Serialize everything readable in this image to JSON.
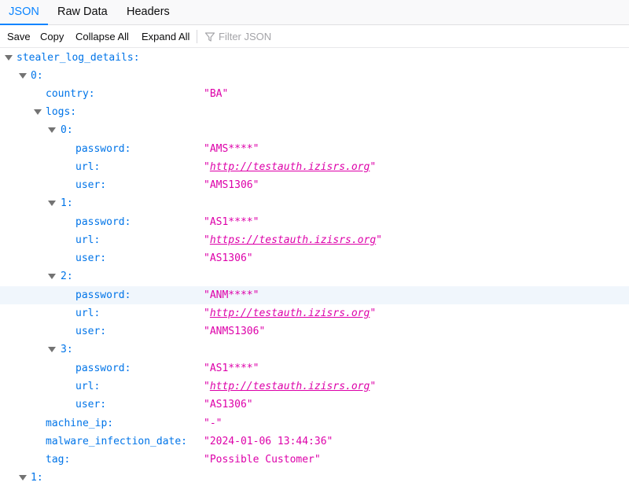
{
  "tabs": {
    "json": "JSON",
    "raw": "Raw Data",
    "headers": "Headers"
  },
  "toolbar": {
    "save": "Save",
    "copy": "Copy",
    "collapse_all": "Collapse All",
    "expand_all": "Expand All",
    "filter_placeholder": "Filter JSON"
  },
  "icons": {
    "filter": "filter-icon",
    "twisty": "chevron-down-icon"
  },
  "colors": {
    "accent": "#0a84ff",
    "key": "#0074e8",
    "string": "#dd00a9",
    "highlight": "#f0f6fc"
  },
  "tree": [
    {
      "k": "stealer_log_details:"
    },
    {
      "k": "0:"
    },
    {
      "k": "country:",
      "v": "\"BA\""
    },
    {
      "k": "logs:"
    },
    {
      "k": "0:"
    },
    {
      "k": "password:",
      "v": "\"AMS****\""
    },
    {
      "k": "url:",
      "u": "http://testauth.izisrs.org"
    },
    {
      "k": "user:",
      "v": "\"AMS1306\""
    },
    {
      "k": "1:"
    },
    {
      "k": "password:",
      "v": "\"AS1****\""
    },
    {
      "k": "url:",
      "u": "https://testauth.izisrs.org"
    },
    {
      "k": "user:",
      "v": "\"AS1306\""
    },
    {
      "k": "2:"
    },
    {
      "k": "password:",
      "v": "\"ANM****\""
    },
    {
      "k": "url:",
      "u": "http://testauth.izisrs.org"
    },
    {
      "k": "user:",
      "v": "\"ANMS1306\""
    },
    {
      "k": "3:"
    },
    {
      "k": "password:",
      "v": "\"AS1****\""
    },
    {
      "k": "url:",
      "u": "http://testauth.izisrs.org"
    },
    {
      "k": "user:",
      "v": "\"AS1306\""
    },
    {
      "k": "machine_ip:",
      "v": "\"-\""
    },
    {
      "k": "malware_infection_date:",
      "v": "\"2024-01-06 13:44:36\""
    },
    {
      "k": "tag:",
      "v": "\"Possible Customer\""
    },
    {
      "k": "1:"
    }
  ]
}
